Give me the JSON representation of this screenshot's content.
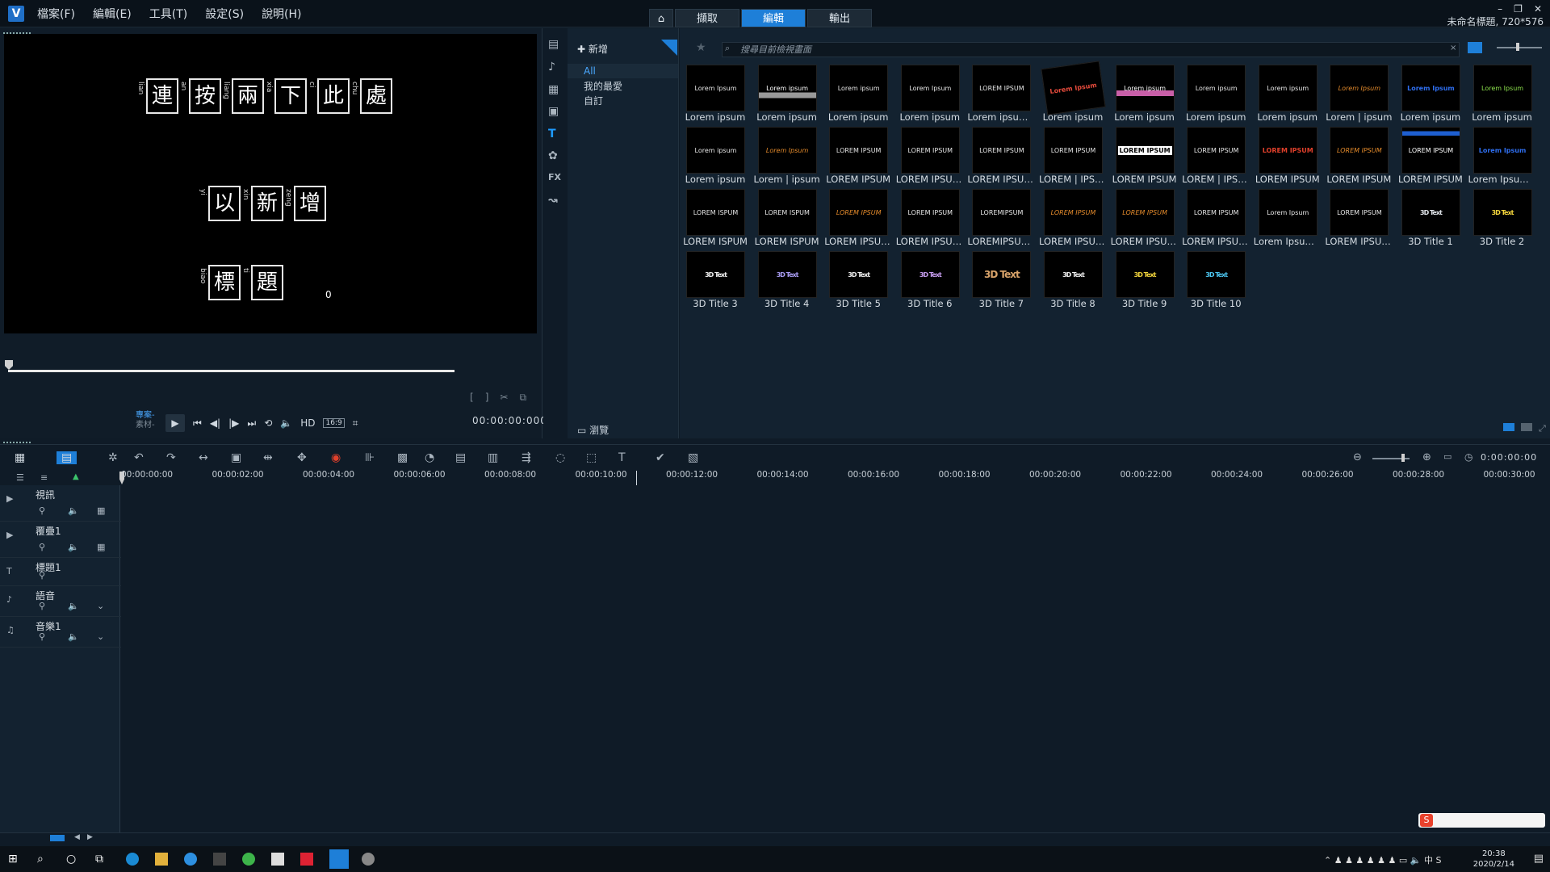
{
  "app": {
    "logo": "V",
    "project_name": "未命名標題, 720*576"
  },
  "menu": [
    "檔案(F)",
    "編輯(E)",
    "工具(T)",
    "設定(S)",
    "說明(H)"
  ],
  "mode_tabs": {
    "home_icon": "home-icon",
    "items": [
      "擷取",
      "編輯",
      "輸出"
    ],
    "active": "編輯"
  },
  "window_controls": [
    "–",
    "❐",
    "✕"
  ],
  "preview": {
    "chars": [
      "連",
      "按",
      "兩",
      "下",
      "此",
      "處",
      "以",
      "新",
      "增",
      "標",
      "題"
    ],
    "ruby": [
      "lian",
      "an",
      "liang",
      "xia",
      "ci",
      "chu",
      "yi",
      "xin",
      "zeng",
      "biao",
      "ti"
    ],
    "cursor": "0",
    "proj_label": "專案-",
    "clip_label": "素材-",
    "hd": "HD",
    "aspect": "16:9",
    "timecode": "00:00:00:000",
    "progress": 0
  },
  "library": {
    "add_label": "新增",
    "categories": [
      "All",
      "我的最愛",
      "自訂"
    ],
    "selected_category": "All",
    "search_placeholder": "搜尋目前檢視畫面",
    "browse_label": "瀏覽",
    "side_icons": [
      "media-icon",
      "music-icon",
      "transition-icon",
      "graphic-icon",
      "title-icon",
      "filter-icon",
      "fx-label",
      "path-icon"
    ],
    "fx": "FX",
    "items": [
      {
        "cap": "Lorem ipsum",
        "img": "Lorem Ipsum",
        "kind": "text"
      },
      {
        "cap": "Lorem ipsum",
        "img": "Lorem ipsum",
        "kind": "bar"
      },
      {
        "cap": "Lorem ipsum",
        "img": "Lorem ipsum",
        "kind": "text"
      },
      {
        "cap": "Lorem ipsum",
        "img": "Lorem Ipsum",
        "kind": "text"
      },
      {
        "cap": "Lorem ipsum d...",
        "img": "LOREM IPSUM",
        "kind": "text"
      },
      {
        "cap": "Lorem ipsum",
        "img": "Lorem Ipsum",
        "kind": "color"
      },
      {
        "cap": "Lorem ipsum",
        "img": "Lorem ipsum",
        "kind": "pinkbar"
      },
      {
        "cap": "Lorem ipsum",
        "img": "Lorem ipsum",
        "kind": "text"
      },
      {
        "cap": "Lorem ipsum",
        "img": "Lorem ipsum",
        "kind": "text"
      },
      {
        "cap": "Lorem | ipsum",
        "img": "Lorem Ipsum",
        "kind": "orange"
      },
      {
        "cap": "Lorem ipsum",
        "img": "Lorem Ipsum",
        "kind": "blue"
      },
      {
        "cap": "Lorem ipsum",
        "img": "Lorem Ipsum",
        "kind": "green"
      },
      {
        "cap": "Lorem ipsum",
        "img": "Lorem ipsum",
        "kind": "text"
      },
      {
        "cap": "Lorem | ipsum",
        "img": "Lorem Ipsum",
        "kind": "orange"
      },
      {
        "cap": "LOREM IPSUM",
        "img": "LOREM IPSUM",
        "kind": "text"
      },
      {
        "cap": "LOREM IPSUM |...",
        "img": "LOREM IPSUM",
        "kind": "text"
      },
      {
        "cap": "LOREM IPSUM |...",
        "img": "LOREM IPSUM",
        "kind": "text"
      },
      {
        "cap": "LOREM | IPSUM",
        "img": "LOREM IPSUM",
        "kind": "text"
      },
      {
        "cap": "LOREM IPSUM",
        "img": "LOREM IPSUM",
        "kind": "box"
      },
      {
        "cap": "LOREM | IPSUM...",
        "img": "LOREM IPSUM",
        "kind": "text"
      },
      {
        "cap": "LOREM IPSUM",
        "img": "LOREM IPSUM",
        "kind": "red"
      },
      {
        "cap": "LOREM IPSUM",
        "img": "LOREM IPSUM",
        "kind": "orange"
      },
      {
        "cap": "LOREM IPSUM",
        "img": "LOREM IPSUM",
        "kind": "bluebar"
      },
      {
        "cap": "Lorem Ipsum | ...",
        "img": "Lorem Ipsum",
        "kind": "blue"
      },
      {
        "cap": "LOREM ISPUM",
        "img": "LOREM ISPUM",
        "kind": "text"
      },
      {
        "cap": "LOREM ISPUM",
        "img": "LOREM ISPUM",
        "kind": "text"
      },
      {
        "cap": "LOREM IPSUM |...",
        "img": "LOREM IPSUM",
        "kind": "orange"
      },
      {
        "cap": "LOREM IPSUM |...",
        "img": "LOREM IPSUM",
        "kind": "text"
      },
      {
        "cap": "LOREMIPSUM |...",
        "img": "LOREMIPSUM",
        "kind": "text"
      },
      {
        "cap": "LOREM IPSUM |...",
        "img": "LOREM IPSUM",
        "kind": "orange"
      },
      {
        "cap": "LOREM IPSUM |...",
        "img": "LOREM IPSUM",
        "kind": "orange"
      },
      {
        "cap": "LOREM IPSUM |...",
        "img": "LOREM IPSUM",
        "kind": "text"
      },
      {
        "cap": "Lorem Ipsum | ...",
        "img": "Lorem Ipsum",
        "kind": "text"
      },
      {
        "cap": "LOREM IPSUM |...",
        "img": "LOREM IPSUM",
        "kind": "text"
      },
      {
        "cap": "3D Title 1",
        "img": "3D Text",
        "kind": "3d-silver"
      },
      {
        "cap": "3D Title 2",
        "img": "3D Text",
        "kind": "3d-gold"
      },
      {
        "cap": "3D Title 3",
        "img": "3D Text",
        "kind": "3d-white"
      },
      {
        "cap": "3D Title 4",
        "img": "3D Text",
        "kind": "3d-purple"
      },
      {
        "cap": "3D Title 5",
        "img": "3D Text",
        "kind": "3d-white"
      },
      {
        "cap": "3D Title 6",
        "img": "3D Text",
        "kind": "3d-violet"
      },
      {
        "cap": "3D Title 7",
        "img": "3D Text",
        "kind": "3d-small"
      },
      {
        "cap": "3D Title 8",
        "img": "3D Text",
        "kind": "3d-white"
      },
      {
        "cap": "3D Title 9",
        "img": "3D Text",
        "kind": "3d-gold"
      },
      {
        "cap": "3D Title 10",
        "img": "3D Text",
        "kind": "3d-cyan"
      }
    ]
  },
  "timeline": {
    "timecode": "0:00:00:00",
    "ruler": [
      "00:00:00:00",
      "00:00:02:00",
      "00:00:04:00",
      "00:00:06:00",
      "00:00:08:00",
      "00:00:10:00",
      "00:00:12:00",
      "00:00:14:00",
      "00:00:16:00",
      "00:00:18:00",
      "00:00:20:00",
      "00:00:22:00",
      "00:00:24:00",
      "00:00:26:00",
      "00:00:28:00",
      "00:00:30:00"
    ],
    "tracks": [
      "視訊",
      "覆疊1",
      "標題1",
      "語音",
      "音樂1"
    ]
  },
  "taskbar": {
    "time": "20:38",
    "date": "2020/2/14"
  },
  "colors": {
    "accent": "#1e7fd8",
    "bg": "#0f1b27",
    "panel": "#132230"
  }
}
